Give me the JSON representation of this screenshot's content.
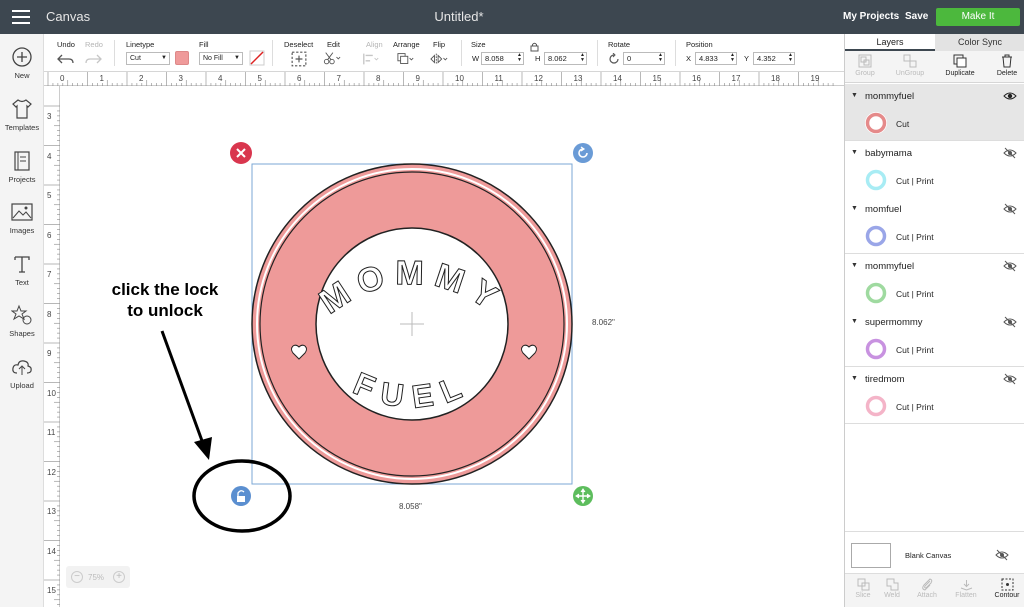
{
  "topbar": {
    "app_title": "Canvas",
    "doc_title": "Untitled*",
    "my_projects": "My Projects",
    "save": "Save",
    "make_it": "Make It"
  },
  "toolbar": {
    "undo": "Undo",
    "redo": "Redo",
    "linetype_label": "Linetype",
    "linetype_value": "Cut",
    "fill_label": "Fill",
    "fill_value": "No Fill",
    "fill_color": "#ef9a9a",
    "deselect": "Deselect",
    "edit": "Edit",
    "align": "Align",
    "arrange": "Arrange",
    "flip": "Flip",
    "size_label": "Size",
    "w_label": "W",
    "w_value": "8.058",
    "h_label": "H",
    "h_value": "8.062",
    "rotate_label": "Rotate",
    "rotate_value": "0",
    "position_label": "Position",
    "x_label": "X",
    "x_value": "4.833",
    "y_label": "Y",
    "y_value": "4.352"
  },
  "sidebar": {
    "items": [
      {
        "label": "New",
        "icon": "plus-circle-icon"
      },
      {
        "label": "Templates",
        "icon": "tshirt-icon"
      },
      {
        "label": "Projects",
        "icon": "notebook-icon"
      },
      {
        "label": "Images",
        "icon": "image-icon"
      },
      {
        "label": "Text",
        "icon": "text-t-icon"
      },
      {
        "label": "Shapes",
        "icon": "shapes-icon"
      },
      {
        "label": "Upload",
        "icon": "cloud-upload-icon"
      }
    ]
  },
  "rulers": {
    "top": [
      "0",
      "1",
      "2",
      "3",
      "4",
      "5",
      "6",
      "7",
      "8",
      "9",
      "10",
      "11",
      "12",
      "13",
      "14",
      "15",
      "16",
      "17",
      "18",
      "19"
    ],
    "left": [
      "3",
      "4",
      "5",
      "6",
      "7",
      "8",
      "9",
      "10",
      "11",
      "12",
      "13",
      "14",
      "15"
    ]
  },
  "canvas": {
    "design_top_text": "MOMMY",
    "design_bottom_text": "FUEL",
    "ring_color": "#ee9a99",
    "height_dim": "8.062\"",
    "width_dim": "8.058\"",
    "annotation_line1": "click the lock",
    "annotation_line2": "to unlock"
  },
  "zoom": {
    "value": "75%"
  },
  "layers_panel": {
    "tab_layers": "Layers",
    "tab_color_sync": "Color Sync",
    "group": "Group",
    "ungroup": "UnGroup",
    "duplicate": "Duplicate",
    "delete": "Delete",
    "layers": [
      {
        "name": "mommyfuel",
        "type": "Cut",
        "thumb_color": "#e58a8a",
        "selected": true
      },
      {
        "name": "babymama",
        "type": "Cut  | Print",
        "thumb_color": "#a8ecf4",
        "selected": false
      },
      {
        "name": "momfuel",
        "type": "Cut  | Print",
        "thumb_color": "#9aa6e8",
        "selected": false
      },
      {
        "name": "mommyfuel",
        "type": "Cut  | Print",
        "thumb_color": "#9fdaa0",
        "selected": false
      },
      {
        "name": "supermommy",
        "type": "Cut  | Print",
        "thumb_color": "#c892e0",
        "selected": false
      },
      {
        "name": "tiredmom",
        "type": "Cut  | Print",
        "thumb_color": "#f4b4c8",
        "selected": false
      }
    ],
    "blank_canvas": "Blank Canvas",
    "slice": "Slice",
    "weld": "Weld",
    "attach": "Attach",
    "flatten": "Flatten",
    "contour": "Contour"
  }
}
